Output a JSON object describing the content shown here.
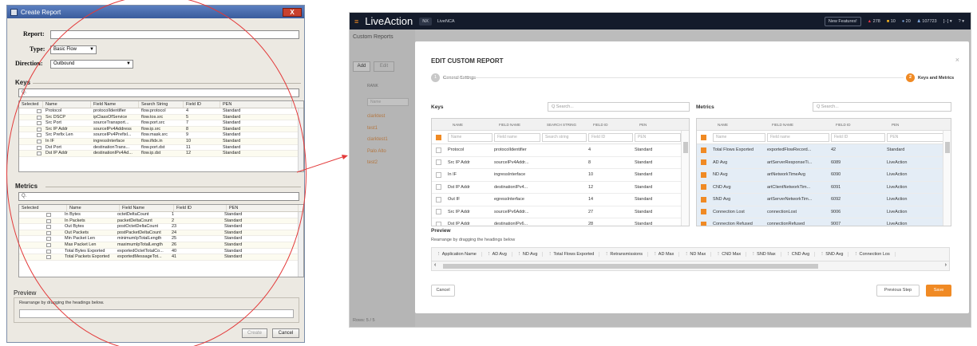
{
  "left": {
    "window_title": "Create Report",
    "close_glyph": "X",
    "report_label": "Report:",
    "type_label": "Type:",
    "type_value": "Basic Flow",
    "direction_label": "Direction:",
    "direction_value": "Outbound",
    "keys_title": "Keys",
    "search_placeholder": "Q.",
    "keys_headers": [
      "Selected",
      "Name",
      "Field Name",
      "Search String",
      "Field ID",
      "PEN"
    ],
    "keys_rows": [
      [
        "Protocol",
        "protocolIdentifier",
        "flow.protocol",
        "4",
        "Standard"
      ],
      [
        "Src DSCP",
        "ipClassOfService",
        "flow.tos.src",
        "5",
        "Standard"
      ],
      [
        "Src Port",
        "sourceTransport...",
        "flow.port.src",
        "7",
        "Standard"
      ],
      [
        "Src IP Addr",
        "sourceIPv4Address",
        "flow.ip.src",
        "8",
        "Standard"
      ],
      [
        "Src Prefix Len",
        "sourceIPv4Prefixl...",
        "flow.mask.src",
        "9",
        "Standard"
      ],
      [
        "In IF",
        "ingressInterface",
        "flow.ifidx.in",
        "10",
        "Standard"
      ],
      [
        "Dst Port",
        "destinationTrans...",
        "flow.port.dst",
        "11",
        "Standard"
      ],
      [
        "Dst IP Addr",
        "destinationIPv4Ad...",
        "flow.ip.dst",
        "12",
        "Standard"
      ]
    ],
    "metrics_title": "Metrics",
    "metrics_search": "Q.",
    "metrics_headers": [
      "Selected",
      "Name",
      "Field Name",
      "Field ID",
      "PEN"
    ],
    "metrics_rows": [
      [
        "In Bytes",
        "octetDeltaCount",
        "1",
        "Standard"
      ],
      [
        "In Packets",
        "packetDeltaCount",
        "2",
        "Standard"
      ],
      [
        "Out Bytes",
        "postOctetDeltaCount",
        "23",
        "Standard"
      ],
      [
        "Out Packets",
        "postPacketDeltaCount",
        "24",
        "Standard"
      ],
      [
        "Min Packet Len",
        "minimumIpTotalLength",
        "25",
        "Standard"
      ],
      [
        "Max Packet Len",
        "maximumIpTotalLength",
        "26",
        "Standard"
      ],
      [
        "Total Bytes Exported",
        "exportedOctetTotalCo...",
        "40",
        "Standard"
      ],
      [
        "Total Packets Exported",
        "exportedMessageTot...",
        "41",
        "Standard"
      ]
    ],
    "preview_title": "Preview",
    "preview_hint": "Rearrange by dragging the headings below.",
    "create_label": "Create",
    "cancel_label": "Cancel"
  },
  "right": {
    "logo": "LiveAction",
    "tag1": "NX",
    "tag2": "LiveNCA",
    "new_features": "New Features!",
    "stat_red": "278",
    "stat_yellow": "10",
    "stat_blue": "20",
    "stat_users": "107723",
    "bg_title": "Custom Reports",
    "bg_add": "Add",
    "bg_edit": "Edit",
    "bg_col": "RANK",
    "bg_name_ph": "Name",
    "bg_rows": [
      "clarktest",
      "test1",
      "clarktest1",
      "Palo Alto",
      "test2"
    ],
    "bg_footer": "Rows: 5 / 5",
    "modal_title": "EDIT CUSTOM REPORT",
    "close_glyph": "×",
    "step1_num": "1",
    "step1_label": "General Settings",
    "step2_num": "2",
    "step2_label": "Keys and Metrics",
    "keys_title": "Keys",
    "keys_search": "Q  Search...",
    "keys_headers": [
      "NAME",
      "FIELD NAME",
      "SEARCH STRING",
      "FIELD ID",
      "PEN"
    ],
    "keys_filters": [
      "Name",
      "Field name",
      "Search string",
      "Field ID",
      "PEN"
    ],
    "keys_rows": [
      [
        "Protocol",
        "protocolIdentifier",
        "",
        "4",
        "Standard"
      ],
      [
        "Src IP Addr",
        "sourceIPv4Addr...",
        "",
        "8",
        "Standard"
      ],
      [
        "In IF",
        "ingressInterface",
        "",
        "10",
        "Standard"
      ],
      [
        "Dst IP Addr",
        "destinationIPv4...",
        "",
        "12",
        "Standard"
      ],
      [
        "Out IF",
        "egressInterface",
        "",
        "14",
        "Standard"
      ],
      [
        "Src IP Addr",
        "sourceIPv6Addr...",
        "",
        "27",
        "Standard"
      ],
      [
        "Dst IP Addr",
        "destinationIPv6...",
        "",
        "28",
        "Standard"
      ]
    ],
    "metrics_title": "Metrics",
    "metrics_search": "Q  Search...",
    "metrics_headers": [
      "NAME",
      "FIELD NAME",
      "FIELD ID",
      "PEN"
    ],
    "metrics_filters": [
      "Name",
      "Field name",
      "Field ID",
      "PEN"
    ],
    "metrics_rows": [
      [
        "Total Flows Exported",
        "exportedFlowRecord...",
        "42",
        "Standard"
      ],
      [
        "AD Avg",
        "artServerResponseTi...",
        "6089",
        "LiveAction"
      ],
      [
        "ND Avg",
        "artNetworkTimeAvg",
        "6090",
        "LiveAction"
      ],
      [
        "CND Avg",
        "artClientNetworkTim...",
        "6091",
        "LiveAction"
      ],
      [
        "SND Avg",
        "artServerNetworkTim...",
        "6092",
        "LiveAction"
      ],
      [
        "Connection Lost",
        "connectionLost",
        "9006",
        "LiveAction"
      ],
      [
        "Connection Refused",
        "connectionRefused",
        "9007",
        "LiveAction"
      ]
    ],
    "preview_title": "Preview",
    "preview_hint": "Rearrange by dragging the headings below",
    "preview_cols": [
      "Application Name",
      "AD Avg",
      "ND Avg",
      "Total Flows Exported",
      "Retransmissions",
      "AD Max",
      "ND Max",
      "CND Max",
      "SND Max",
      "CND Avg",
      "SND Avg",
      "Connection Los"
    ],
    "cancel_label": "Cancel",
    "prev_label": "Previous Step",
    "save_label": "Save"
  },
  "colors": {
    "accent": "#f08a24",
    "annotation": "#e33a3a",
    "topbar": "#141b2b"
  }
}
